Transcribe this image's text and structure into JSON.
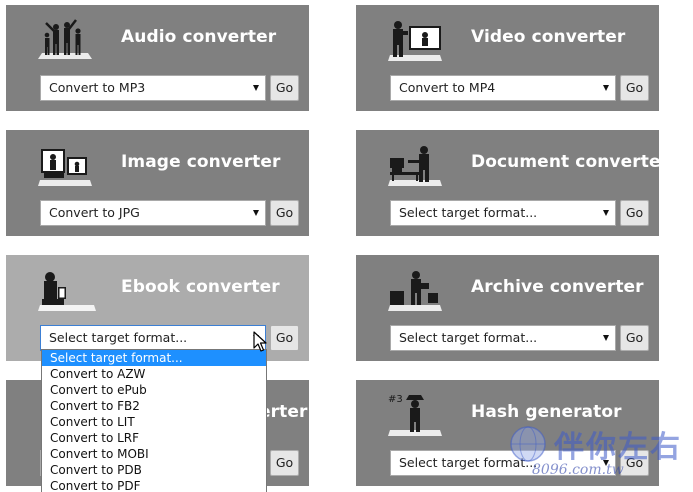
{
  "cards": [
    {
      "title": "Audio converter",
      "select_value": "Convert to MP3",
      "go_label": "Go"
    },
    {
      "title": "Video converter",
      "select_value": "Convert to MP4",
      "go_label": "Go"
    },
    {
      "title": "Image converter",
      "select_value": "Convert to JPG",
      "go_label": "Go"
    },
    {
      "title": "Document converter",
      "select_value": "Select target format...",
      "go_label": "Go"
    },
    {
      "title": "Ebook converter",
      "select_value": "Select target format...",
      "go_label": "Go"
    },
    {
      "title": "Archive converter",
      "select_value": "Select target format...",
      "go_label": "Go"
    },
    {
      "title": "Webservice converter",
      "title_visible": "erter",
      "select_value": "",
      "go_label": "Go"
    },
    {
      "title": "Hash generator",
      "select_value": "Select target format...",
      "go_label": "Go"
    }
  ],
  "ebook_dropdown": {
    "options": [
      "Select target format...",
      "Convert to AZW",
      "Convert to ePub",
      "Convert to FB2",
      "Convert to LIT",
      "Convert to LRF",
      "Convert to MOBI",
      "Convert to PDB",
      "Convert to PDF"
    ],
    "selected_index": 0
  },
  "watermark": {
    "logo_text": "伴你左右",
    "sub_text": "8096.com.tw"
  },
  "colors": {
    "card_bg": "#808080",
    "card_active_bg": "#acacac",
    "highlight": "#1e90ff"
  }
}
